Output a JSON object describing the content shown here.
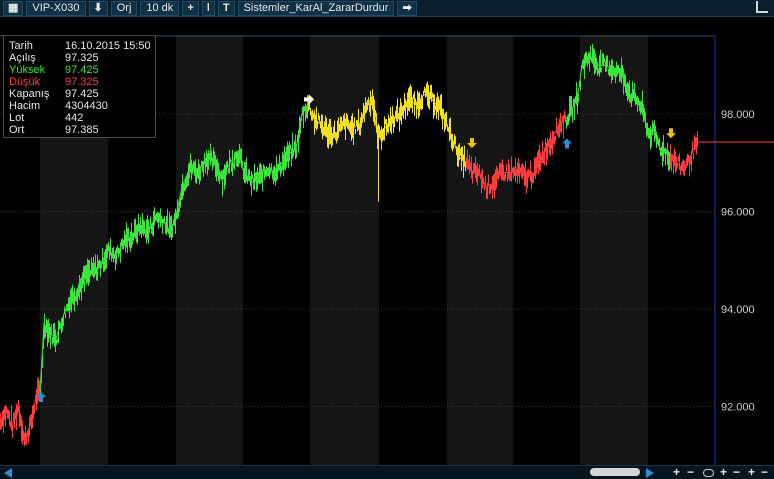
{
  "toolbar": {
    "menu_icon": "grid-icon",
    "symbol": "VIP-X030",
    "down_icon": "down-arrow-icon",
    "origin": "Orj",
    "period": "10 dk",
    "plus_icon": "plus-icon",
    "bar_icon": "bar-icon",
    "system_icon": "T",
    "system_name": "Sistemler_KarAl_ZararDurdur",
    "next_icon": "right-arrow-icon"
  },
  "info": {
    "rows": [
      {
        "k": "Tarih",
        "v": "16.10.2015 15:50",
        "color": "#e6e6e6"
      },
      {
        "k": "Açılış",
        "v": "97.325",
        "color": "#e6e6e6"
      },
      {
        "k": "Yüksek",
        "v": "97.425",
        "color": "#39e639"
      },
      {
        "k": "Düşük",
        "v": "97.325",
        "color": "#ff3b3b"
      },
      {
        "k": "Kapanış",
        "v": "97.425",
        "color": "#e6e6e6"
      },
      {
        "k": "Hacim",
        "v": "4304430",
        "color": "#e6e6e6"
      },
      {
        "k": "Lot",
        "v": "442",
        "color": "#e6e6e6"
      },
      {
        "k": "Ort",
        "v": "97.385",
        "color": "#e6e6e6"
      }
    ]
  },
  "axis": {
    "labels": [
      "98.000",
      "96.000",
      "94.000",
      "92.000"
    ],
    "current_price": "97.425"
  },
  "colors": {
    "up": "#39e639",
    "neutral": "#f0e020",
    "down": "#ff3b3b",
    "buy_arrow": "#2d8fd1",
    "sell_arrow": "#f0c000",
    "entry_arrow": "#ffffff"
  },
  "bottom": {
    "buttons": [
      "+",
      "−",
      "+",
      "−",
      "+",
      "−"
    ]
  },
  "chart_data": {
    "type": "line",
    "ylim": [
      90.8,
      99.6
    ],
    "grid": true,
    "segments": [
      {
        "state": "down",
        "points": [
          [
            0,
            91.7
          ],
          [
            6,
            91.9
          ],
          [
            12,
            91.6
          ],
          [
            18,
            92.0
          ],
          [
            24,
            91.3
          ],
          [
            30,
            91.6
          ],
          [
            36,
            92.2
          ],
          [
            40,
            92.3
          ]
        ]
      },
      {
        "state": "up",
        "points": [
          [
            40,
            92.3
          ],
          [
            44,
            93.7
          ],
          [
            50,
            93.5
          ],
          [
            56,
            93.4
          ],
          [
            64,
            93.9
          ],
          [
            70,
            94.2
          ],
          [
            78,
            94.4
          ],
          [
            86,
            94.7
          ],
          [
            94,
            94.8
          ],
          [
            100,
            94.9
          ],
          [
            108,
            95.2
          ],
          [
            116,
            95.1
          ],
          [
            124,
            95.4
          ],
          [
            132,
            95.5
          ],
          [
            140,
            95.7
          ],
          [
            148,
            95.6
          ],
          [
            156,
            95.9
          ],
          [
            164,
            95.8
          ],
          [
            170,
            95.6
          ],
          [
            176,
            95.9
          ],
          [
            182,
            96.5
          ],
          [
            190,
            96.9
          ],
          [
            198,
            96.8
          ],
          [
            206,
            97.1
          ],
          [
            214,
            97.0
          ],
          [
            222,
            96.7
          ],
          [
            230,
            97.0
          ],
          [
            238,
            97.2
          ],
          [
            244,
            96.8
          ],
          [
            252,
            96.6
          ],
          [
            260,
            96.7
          ],
          [
            268,
            96.9
          ],
          [
            276,
            96.8
          ],
          [
            282,
            97.0
          ],
          [
            290,
            97.2
          ],
          [
            296,
            97.3
          ],
          [
            302,
            98.0
          ],
          [
            308,
            98.2
          ]
        ]
      },
      {
        "state": "neutral",
        "points": [
          [
            308,
            98.2
          ],
          [
            314,
            97.9
          ],
          [
            320,
            97.8
          ],
          [
            328,
            97.6
          ],
          [
            336,
            97.6
          ],
          [
            344,
            97.8
          ],
          [
            352,
            97.7
          ],
          [
            360,
            97.8
          ],
          [
            366,
            98.2
          ],
          [
            372,
            98.3
          ],
          [
            378,
            97.5
          ],
          [
            384,
            97.7
          ],
          [
            392,
            97.9
          ],
          [
            400,
            98.0
          ],
          [
            408,
            98.3
          ],
          [
            416,
            98.2
          ],
          [
            424,
            98.4
          ],
          [
            432,
            98.3
          ],
          [
            440,
            98.1
          ],
          [
            448,
            97.7
          ],
          [
            454,
            97.4
          ],
          [
            460,
            97.1
          ],
          [
            466,
            97.0
          ]
        ]
      },
      {
        "state": "down",
        "points": [
          [
            466,
            97.0
          ],
          [
            472,
            96.8
          ],
          [
            478,
            96.8
          ],
          [
            486,
            96.5
          ],
          [
            494,
            96.6
          ],
          [
            502,
            96.8
          ],
          [
            510,
            96.8
          ],
          [
            518,
            96.8
          ],
          [
            526,
            96.7
          ],
          [
            534,
            96.8
          ],
          [
            540,
            97.1
          ],
          [
            546,
            97.3
          ],
          [
            552,
            97.5
          ],
          [
            560,
            97.8
          ],
          [
            566,
            97.9
          ]
        ]
      },
      {
        "state": "up",
        "points": [
          [
            566,
            97.9
          ],
          [
            572,
            98.1
          ],
          [
            578,
            98.4
          ],
          [
            582,
            99.0
          ],
          [
            590,
            99.2
          ],
          [
            598,
            99.0
          ],
          [
            606,
            99.0
          ],
          [
            614,
            98.9
          ],
          [
            622,
            98.8
          ],
          [
            630,
            98.4
          ],
          [
            636,
            98.3
          ],
          [
            642,
            98.1
          ],
          [
            648,
            97.6
          ],
          [
            654,
            97.6
          ],
          [
            660,
            97.3
          ],
          [
            666,
            97.2
          ],
          [
            670,
            97.1
          ]
        ]
      },
      {
        "state": "down",
        "points": [
          [
            670,
            97.1
          ],
          [
            676,
            97.0
          ],
          [
            682,
            96.9
          ],
          [
            688,
            97.0
          ],
          [
            694,
            97.3
          ],
          [
            698,
            97.4
          ]
        ]
      }
    ],
    "signals": [
      {
        "type": "buy",
        "x": 41,
        "y": 92.4
      },
      {
        "type": "entry",
        "x": 309,
        "y": 98.3
      },
      {
        "type": "sell",
        "x": 472,
        "y": 97.2
      },
      {
        "type": "buy",
        "x": 567,
        "y": 97.6
      },
      {
        "type": "sell",
        "x": 671,
        "y": 97.4
      }
    ]
  }
}
